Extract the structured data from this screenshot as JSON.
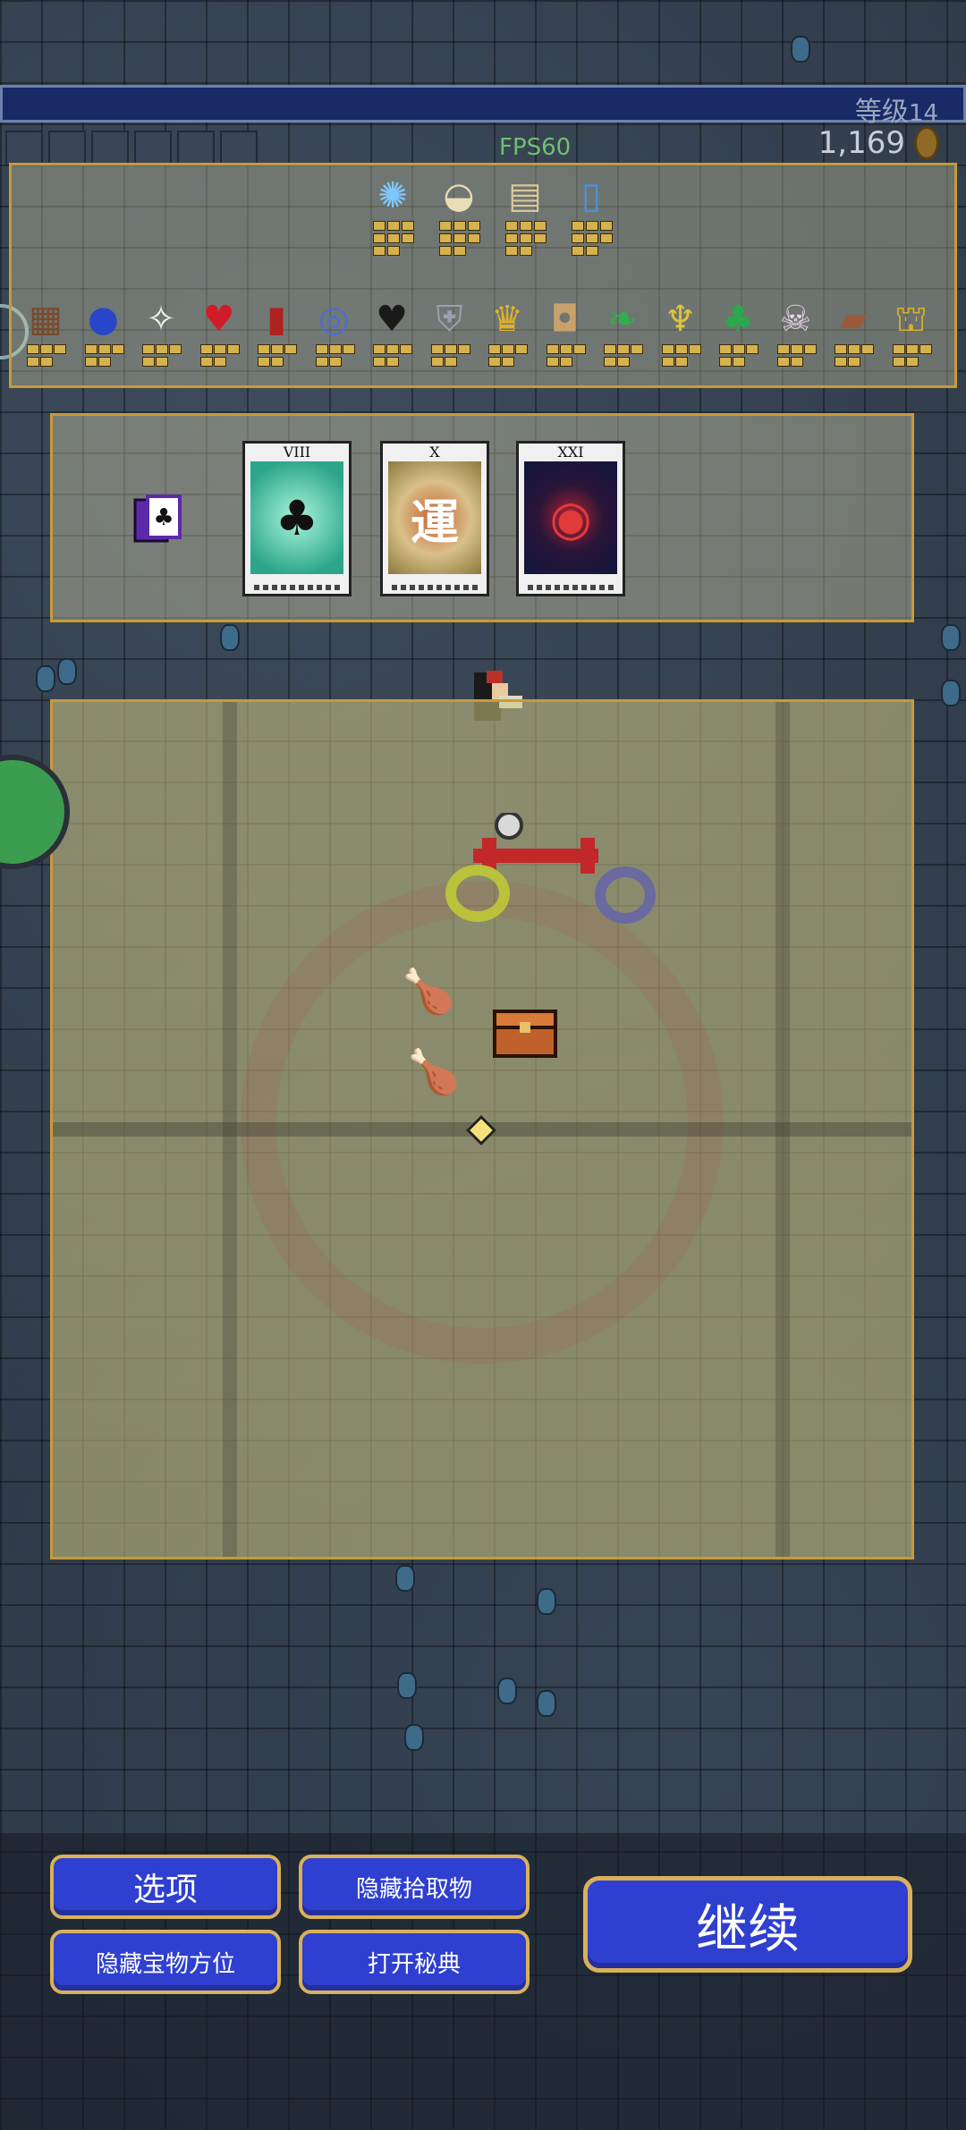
{
  "hud": {
    "level_label": "等级",
    "level_value": "14",
    "fps": "FPS60",
    "gold": "1,169"
  },
  "inventory": {
    "weapons": [
      {
        "name": "lightning-ring-icon",
        "glyph": "✺",
        "color": "#7fc7ff"
      },
      {
        "name": "garlic-icon",
        "glyph": "◒",
        "color": "#e9ddb8"
      },
      {
        "name": "scroll-icon",
        "glyph": "▤",
        "color": "#d9c89a"
      },
      {
        "name": "king-bible-icon",
        "glyph": "▯",
        "color": "#4d8fe0"
      }
    ],
    "passives": [
      {
        "name": "spellbinder-icon",
        "glyph": "▦",
        "color": "#7a4a2a"
      },
      {
        "name": "orb-icon",
        "glyph": "●",
        "color": "#2746c9"
      },
      {
        "name": "wings-icon",
        "glyph": "✧",
        "color": "#f0f0f0"
      },
      {
        "name": "heart-icon",
        "glyph": "♥",
        "color": "#d01c2a"
      },
      {
        "name": "empty-tome-icon",
        "glyph": "▮",
        "color": "#b0221f"
      },
      {
        "name": "attractorb-ring-icon",
        "glyph": "◎",
        "color": "#4a6fd0"
      },
      {
        "name": "black-heart-icon",
        "glyph": "♥",
        "color": "#1a1a1a"
      },
      {
        "name": "armor-icon",
        "glyph": "⛨",
        "color": "#9aa0ad"
      },
      {
        "name": "crown-icon",
        "glyph": "♛",
        "color": "#e0b22a"
      },
      {
        "name": "hollow-heart-icon",
        "glyph": "◘",
        "color": "#c9a26b"
      },
      {
        "name": "feather-icon",
        "glyph": "❧",
        "color": "#2fb04a"
      },
      {
        "name": "candelabra-icon",
        "glyph": "♆",
        "color": "#e0c23a"
      },
      {
        "name": "clover-icon",
        "glyph": "♣",
        "color": "#2aa84a"
      },
      {
        "name": "skull-icon",
        "glyph": "☠",
        "color": "#e6d0e0"
      },
      {
        "name": "bracer-icon",
        "glyph": "▰",
        "color": "#9b5a3a"
      },
      {
        "name": "duplicator-icon",
        "glyph": "⛫",
        "color": "#d8b030"
      }
    ]
  },
  "arcana": {
    "cards": [
      {
        "numeral": "VIII",
        "art": "♣"
      },
      {
        "numeral": "X",
        "art": "運"
      },
      {
        "numeral": "XXI",
        "art": "◉"
      }
    ]
  },
  "buttons": {
    "options": "选项",
    "hide_pickups": "隐藏拾取物",
    "hide_relic_location": "隐藏宝物方位",
    "open_grimoire": "打开秘典",
    "continue": "继续"
  },
  "map": {
    "items": [
      {
        "name": "roast-chicken-icon",
        "glyph": "🍗"
      },
      {
        "name": "roast-chicken-icon",
        "glyph": "🍗"
      },
      {
        "name": "treasure-chest-icon",
        "glyph": "▭"
      }
    ]
  }
}
